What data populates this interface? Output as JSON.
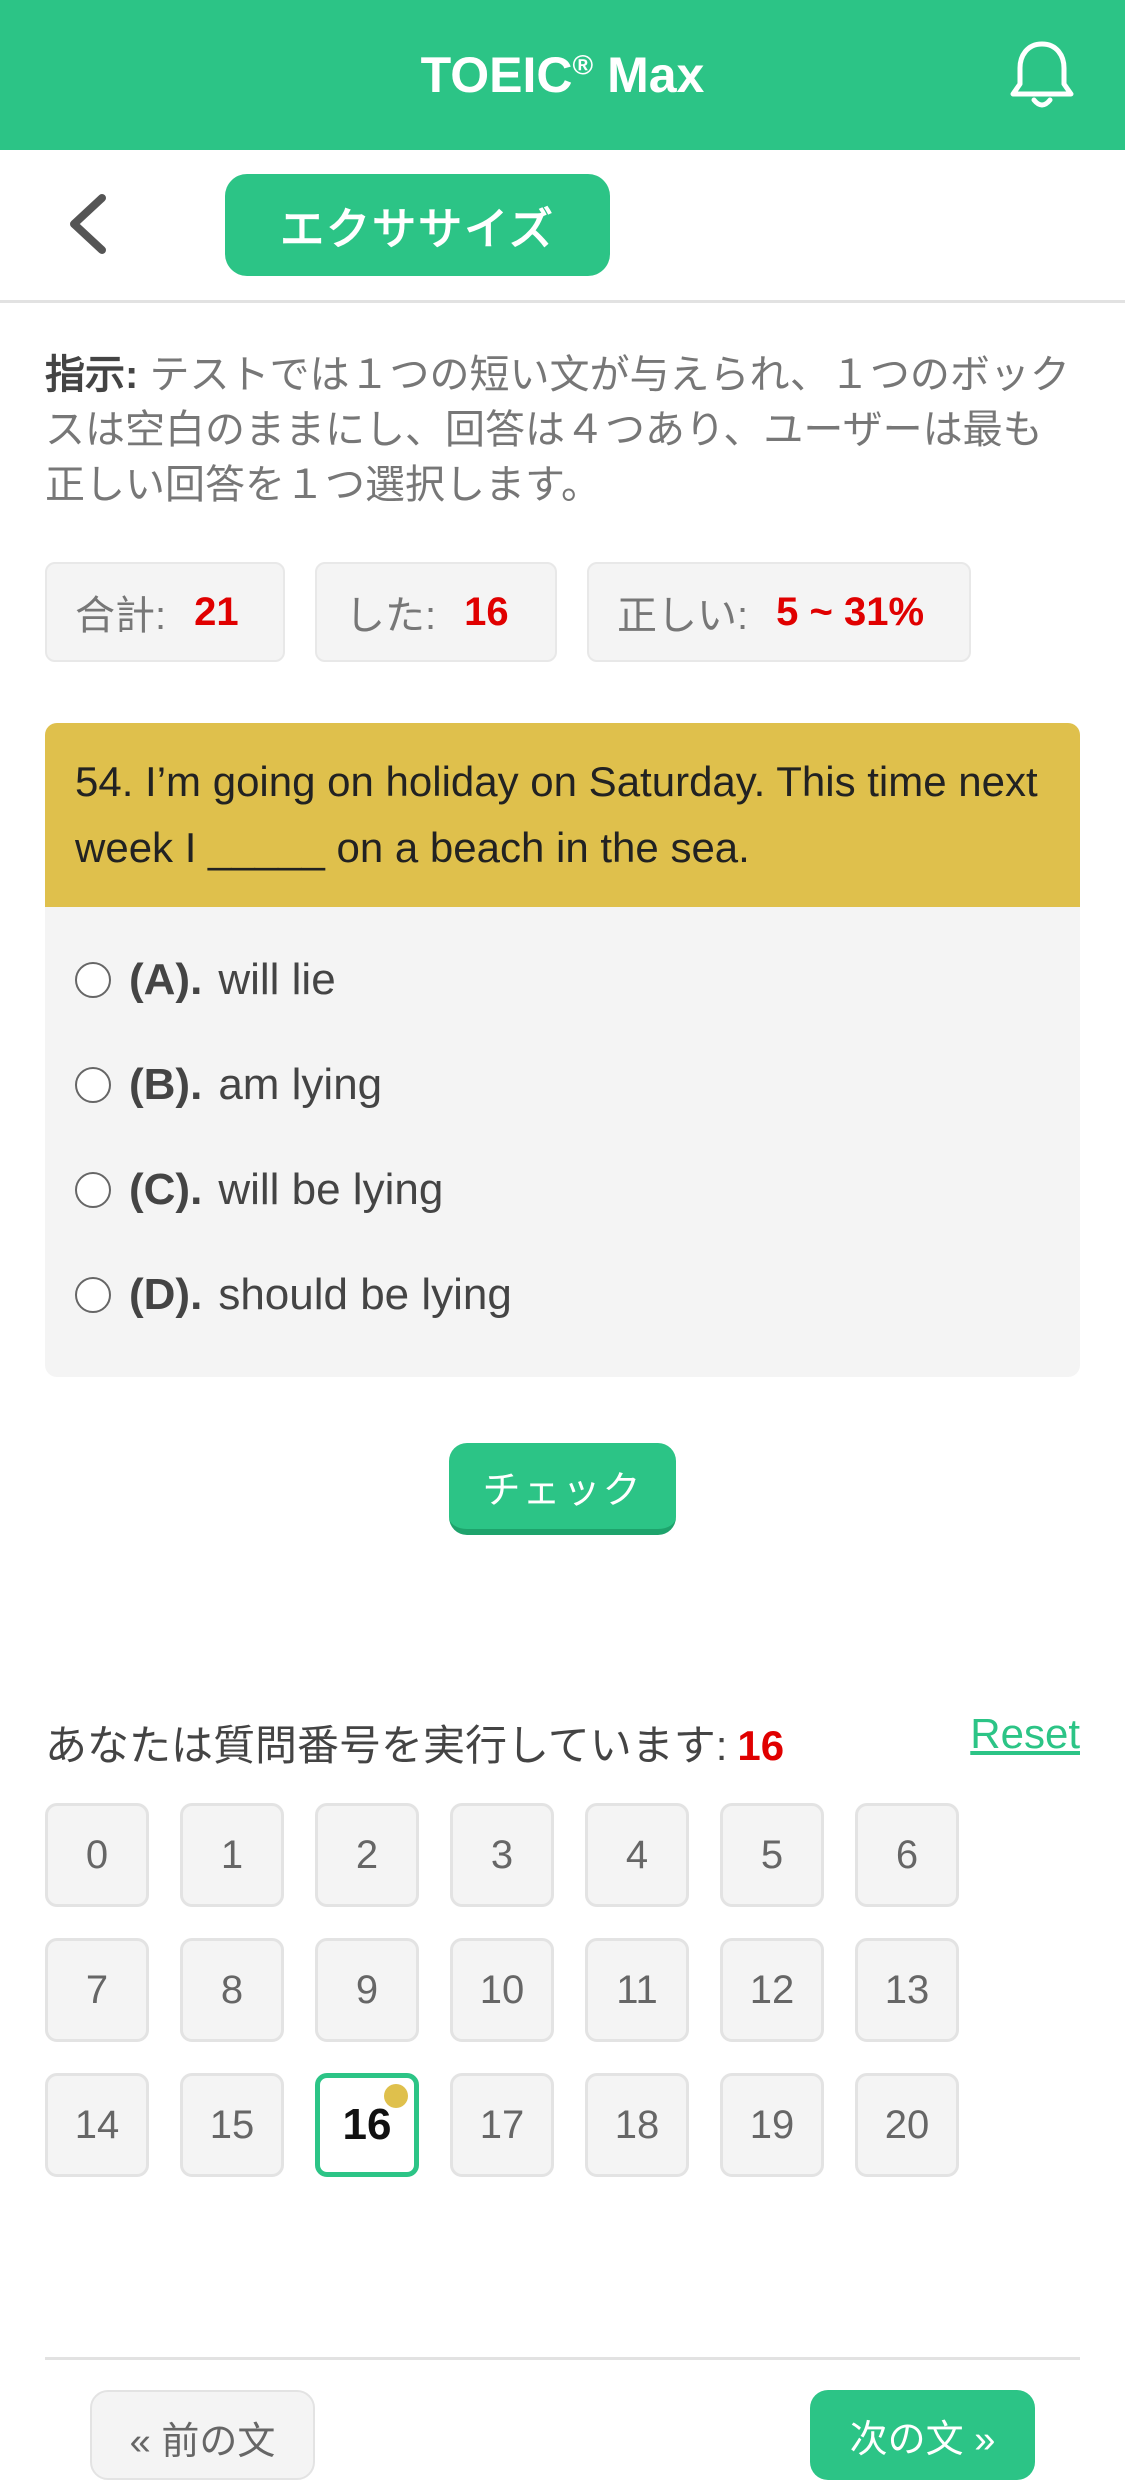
{
  "header": {
    "title": "TOEIC",
    "title_mark": "®",
    "title_suffix": " Max",
    "bell_icon": "bell-icon"
  },
  "subheader": {
    "back_icon": "chevron-left-icon",
    "tab_label": "エクササイズ"
  },
  "instructions": {
    "label": "指示:",
    "text": " テストでは１つの短い文が与えられ、１つのボックスは空白のままにし、回答は４つあり、ユーザーは最も正しい回答を１つ選択します。"
  },
  "stats": {
    "total_label": "合計:",
    "total_value": "21",
    "done_label": "した:",
    "done_value": "16",
    "correct_label": "正しい:",
    "correct_value": "5 ~ 31%"
  },
  "question": {
    "text": "54. I’m going on holiday on Saturday. This time next week I _____ on a beach in the sea.",
    "options": [
      {
        "letter": "(A).",
        "text": "will lie"
      },
      {
        "letter": "(B).",
        "text": "am lying"
      },
      {
        "letter": "(C).",
        "text": "will be lying"
      },
      {
        "letter": "(D).",
        "text": "should be lying"
      }
    ]
  },
  "check_label": "チェック",
  "progress": {
    "label": "あなたは質問番号を実行しています:",
    "current": "16",
    "reset_label": "Reset"
  },
  "question_numbers": [
    "0",
    "1",
    "2",
    "3",
    "4",
    "5",
    "6",
    "7",
    "8",
    "9",
    "10",
    "11",
    "12",
    "13",
    "14",
    "15",
    "16",
    "17",
    "18",
    "19",
    "20"
  ],
  "active_question": "16",
  "nav": {
    "prev_label": "« 前の文",
    "next_label": "次の文 »"
  },
  "colors": {
    "brand": "#2cc486",
    "question_bg": "#dfc04c",
    "highlight": "#e00000"
  }
}
